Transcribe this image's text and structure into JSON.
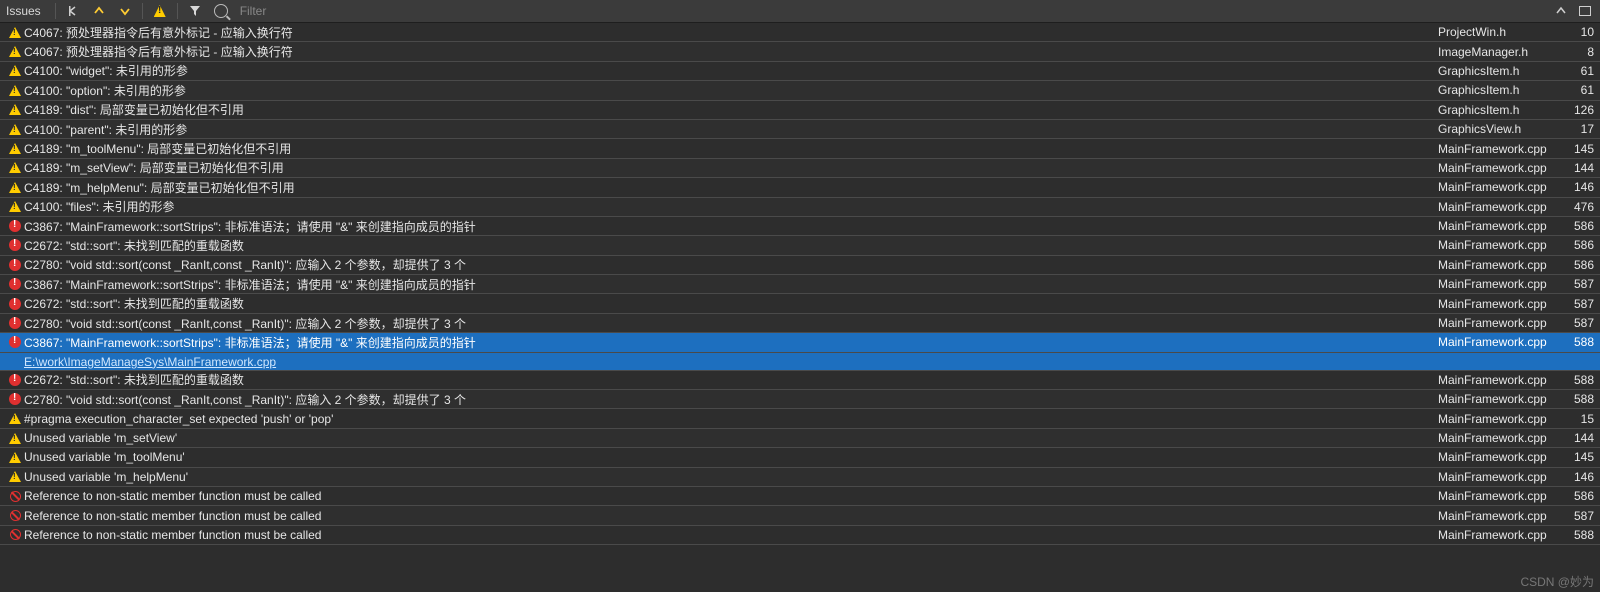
{
  "toolbar": {
    "title": "Issues",
    "filter_placeholder": "Filter"
  },
  "watermark": "CSDN @妙为",
  "selected_index": 15,
  "issues": [
    {
      "type": "warning",
      "msg": "C4067: 预处理器指令后有意外标记 - 应输入换行符",
      "file": "ProjectWin.h",
      "line": 10
    },
    {
      "type": "warning",
      "msg": "C4067: 预处理器指令后有意外标记 - 应输入换行符",
      "file": "ImageManager.h",
      "line": 8
    },
    {
      "type": "warning",
      "msg": "C4100: \"widget\": 未引用的形参",
      "file": "GraphicsItem.h",
      "line": 61
    },
    {
      "type": "warning",
      "msg": "C4100: \"option\": 未引用的形参",
      "file": "GraphicsItem.h",
      "line": 61
    },
    {
      "type": "warning",
      "msg": "C4189: \"dist\": 局部变量已初始化但不引用",
      "file": "GraphicsItem.h",
      "line": 126
    },
    {
      "type": "warning",
      "msg": "C4100: \"parent\": 未引用的形参",
      "file": "GraphicsView.h",
      "line": 17
    },
    {
      "type": "warning",
      "msg": "C4189: \"m_toolMenu\": 局部变量已初始化但不引用",
      "file": "MainFramework.cpp",
      "line": 145
    },
    {
      "type": "warning",
      "msg": "C4189: \"m_setView\": 局部变量已初始化但不引用",
      "file": "MainFramework.cpp",
      "line": 144
    },
    {
      "type": "warning",
      "msg": "C4189: \"m_helpMenu\": 局部变量已初始化但不引用",
      "file": "MainFramework.cpp",
      "line": 146
    },
    {
      "type": "warning",
      "msg": "C4100: \"files\": 未引用的形参",
      "file": "MainFramework.cpp",
      "line": 476
    },
    {
      "type": "error",
      "msg": "C3867: \"MainFramework::sortStrips\": 非标准语法；请使用 \"&\" 来创建指向成员的指针",
      "file": "MainFramework.cpp",
      "line": 586
    },
    {
      "type": "error",
      "msg": "C2672: \"std::sort\": 未找到匹配的重载函数",
      "file": "MainFramework.cpp",
      "line": 586
    },
    {
      "type": "error",
      "msg": "C2780: \"void std::sort(const _RanIt,const _RanIt)\": 应输入 2 个参数，却提供了 3 个",
      "file": "MainFramework.cpp",
      "line": 586
    },
    {
      "type": "error",
      "msg": "C3867: \"MainFramework::sortStrips\": 非标准语法；请使用 \"&\" 来创建指向成员的指针",
      "file": "MainFramework.cpp",
      "line": 587
    },
    {
      "type": "error",
      "msg": "C2672: \"std::sort\": 未找到匹配的重载函数",
      "file": "MainFramework.cpp",
      "line": 587
    },
    {
      "type": "error",
      "msg": "C2780: \"void std::sort(const _RanIt,const _RanIt)\": 应输入 2 个参数，却提供了 3 个",
      "file": "MainFramework.cpp",
      "line": 587
    },
    {
      "type": "error",
      "msg": "C3867: \"MainFramework::sortStrips\": 非标准语法；请使用 \"&\" 来创建指向成员的指针",
      "file": "MainFramework.cpp",
      "line": 588,
      "path": "E:\\work\\ImageManageSys\\MainFramework.cpp"
    },
    {
      "type": "error",
      "msg": "C2672: \"std::sort\": 未找到匹配的重载函数",
      "file": "MainFramework.cpp",
      "line": 588
    },
    {
      "type": "error",
      "msg": "C2780: \"void std::sort(const _RanIt,const _RanIt)\": 应输入 2 个参数，却提供了 3 个",
      "file": "MainFramework.cpp",
      "line": 588
    },
    {
      "type": "warning",
      "msg": "#pragma execution_character_set expected 'push' or 'pop'",
      "file": "MainFramework.cpp",
      "line": 15
    },
    {
      "type": "warning",
      "msg": "Unused variable 'm_setView'",
      "file": "MainFramework.cpp",
      "line": 144
    },
    {
      "type": "warning",
      "msg": "Unused variable 'm_toolMenu'",
      "file": "MainFramework.cpp",
      "line": 145
    },
    {
      "type": "warning",
      "msg": "Unused variable 'm_helpMenu'",
      "file": "MainFramework.cpp",
      "line": 146
    },
    {
      "type": "forbid",
      "msg": "Reference to non-static member function must be called",
      "file": "MainFramework.cpp",
      "line": 586
    },
    {
      "type": "forbid",
      "msg": "Reference to non-static member function must be called",
      "file": "MainFramework.cpp",
      "line": 587
    },
    {
      "type": "forbid",
      "msg": "Reference to non-static member function must be called",
      "file": "MainFramework.cpp",
      "line": 588
    }
  ]
}
